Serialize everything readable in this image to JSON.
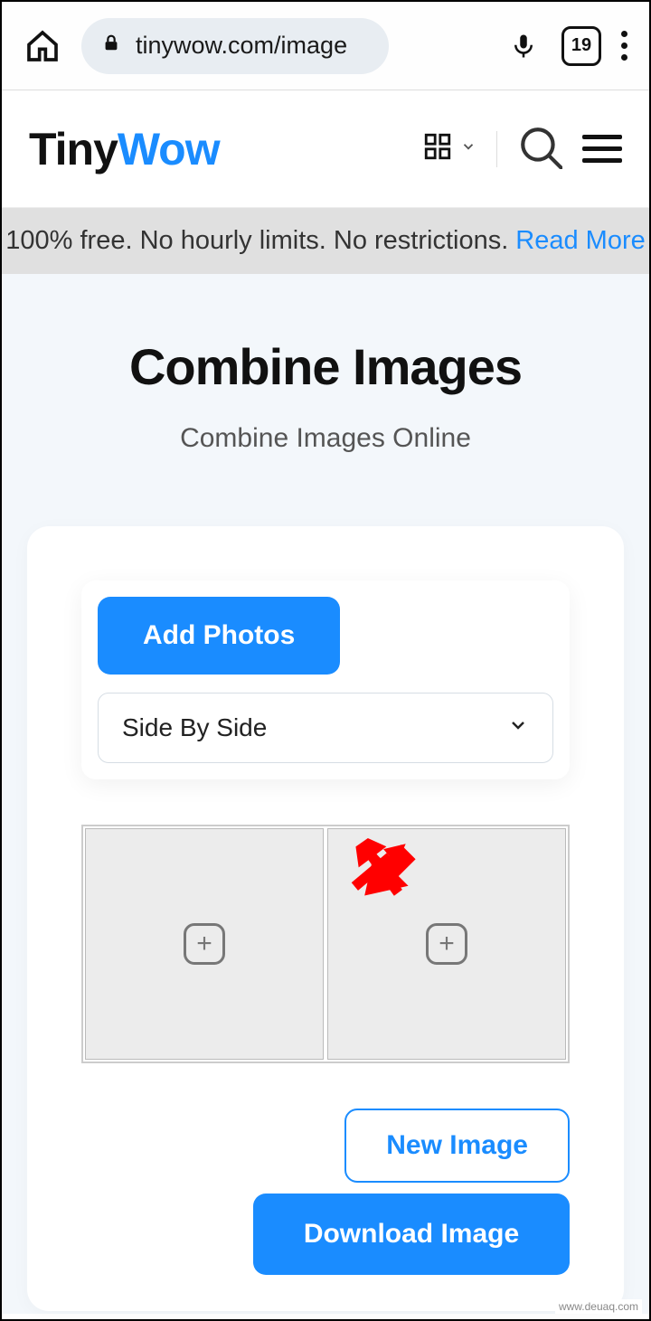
{
  "browser": {
    "url": "tinywow.com/image",
    "tab_count": "19"
  },
  "header": {
    "logo_part1": "Tiny",
    "logo_part2": "Wow"
  },
  "promo": {
    "text": "100% free. No hourly limits. No restrictions.",
    "link": "Read More"
  },
  "page": {
    "title": "Combine Images",
    "subtitle": "Combine Images Online"
  },
  "controls": {
    "add_photos": "Add Photos",
    "layout_selected": "Side By Side",
    "new_image": "New Image",
    "download": "Download Image"
  },
  "watermark": "www.deuaq.com"
}
